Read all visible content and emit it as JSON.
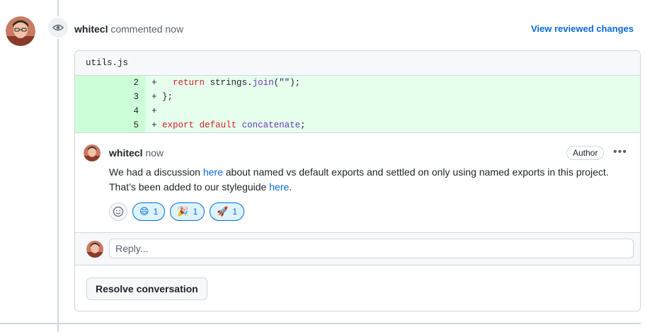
{
  "review": {
    "author": "whitecl",
    "action": "commented now",
    "view_changes_label": "View reviewed changes",
    "icon": "eye-icon"
  },
  "file": {
    "name": "utils.js",
    "lines": [
      {
        "num": "2",
        "prefix": "+",
        "tokens": [
          {
            "t": "   ",
            "c": ""
          },
          {
            "t": "return",
            "c": "kw"
          },
          {
            "t": " strings.",
            "c": ""
          },
          {
            "t": "join",
            "c": "fn"
          },
          {
            "t": "(",
            "c": ""
          },
          {
            "t": "\"\"",
            "c": "str"
          },
          {
            "t": ");",
            "c": ""
          }
        ]
      },
      {
        "num": "3",
        "prefix": "+",
        "tokens": [
          {
            "t": " };",
            "c": ""
          }
        ]
      },
      {
        "num": "4",
        "prefix": "+",
        "tokens": []
      },
      {
        "num": "5",
        "prefix": "+",
        "tokens": [
          {
            "t": " ",
            "c": ""
          },
          {
            "t": "export",
            "c": "kw"
          },
          {
            "t": " ",
            "c": ""
          },
          {
            "t": "default",
            "c": "kw"
          },
          {
            "t": " ",
            "c": ""
          },
          {
            "t": "concatenate",
            "c": "fn"
          },
          {
            "t": ";",
            "c": ""
          }
        ]
      }
    ]
  },
  "comment": {
    "author": "whitecl",
    "time": "now",
    "badge": "Author",
    "menu": "•••",
    "body": {
      "p1": "We had a discussion ",
      "link1": "here",
      "p2": " about named vs default exports and settled on only using named exports in this project. That’s been added to our styleguide ",
      "link2": "here",
      "p3": "."
    },
    "reactions": [
      {
        "emoji": "😄",
        "count": "1",
        "name": "smile-reaction"
      },
      {
        "emoji": "🎉",
        "count": "1",
        "name": "tada-reaction"
      },
      {
        "emoji": "🚀",
        "count": "1",
        "name": "rocket-reaction"
      }
    ]
  },
  "reply": {
    "placeholder": "Reply..."
  },
  "resolve": {
    "label": "Resolve conversation"
  },
  "colors": {
    "link": "#0969da",
    "diff_add_bg": "#e6ffec",
    "diff_num_bg": "#ccffd8",
    "border": "#d0d7de"
  }
}
